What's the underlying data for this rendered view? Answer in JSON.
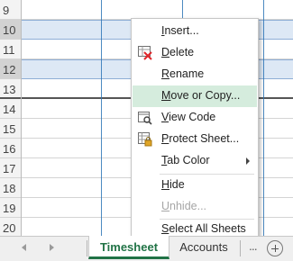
{
  "row_numbers": [
    "9",
    "10",
    "11",
    "12",
    "13",
    "14",
    "15",
    "16",
    "17",
    "18",
    "19",
    "20"
  ],
  "context_menu": {
    "items": [
      {
        "pre": "",
        "key": "I",
        "post": "nsert..."
      },
      {
        "pre": "",
        "key": "D",
        "post": "elete"
      },
      {
        "pre": "",
        "key": "R",
        "post": "ename"
      },
      {
        "pre": "",
        "key": "M",
        "post": "ove or Copy..."
      },
      {
        "pre": "",
        "key": "V",
        "post": "iew Code"
      },
      {
        "pre": "",
        "key": "P",
        "post": "rotect Sheet..."
      },
      {
        "pre": "",
        "key": "T",
        "post": "ab Color"
      },
      {
        "pre": "",
        "key": "H",
        "post": "ide"
      },
      {
        "pre": "",
        "key": "U",
        "post": "nhide..."
      },
      {
        "pre": "",
        "key": "S",
        "post": "elect All Sheets"
      }
    ]
  },
  "tabs": {
    "active": "Timesheet",
    "other": "Accounts",
    "overflow": "..."
  },
  "colors": {
    "accent_green": "#217346",
    "menu_highlight": "#d5ecdd",
    "selected_row": "#dde8f5"
  }
}
